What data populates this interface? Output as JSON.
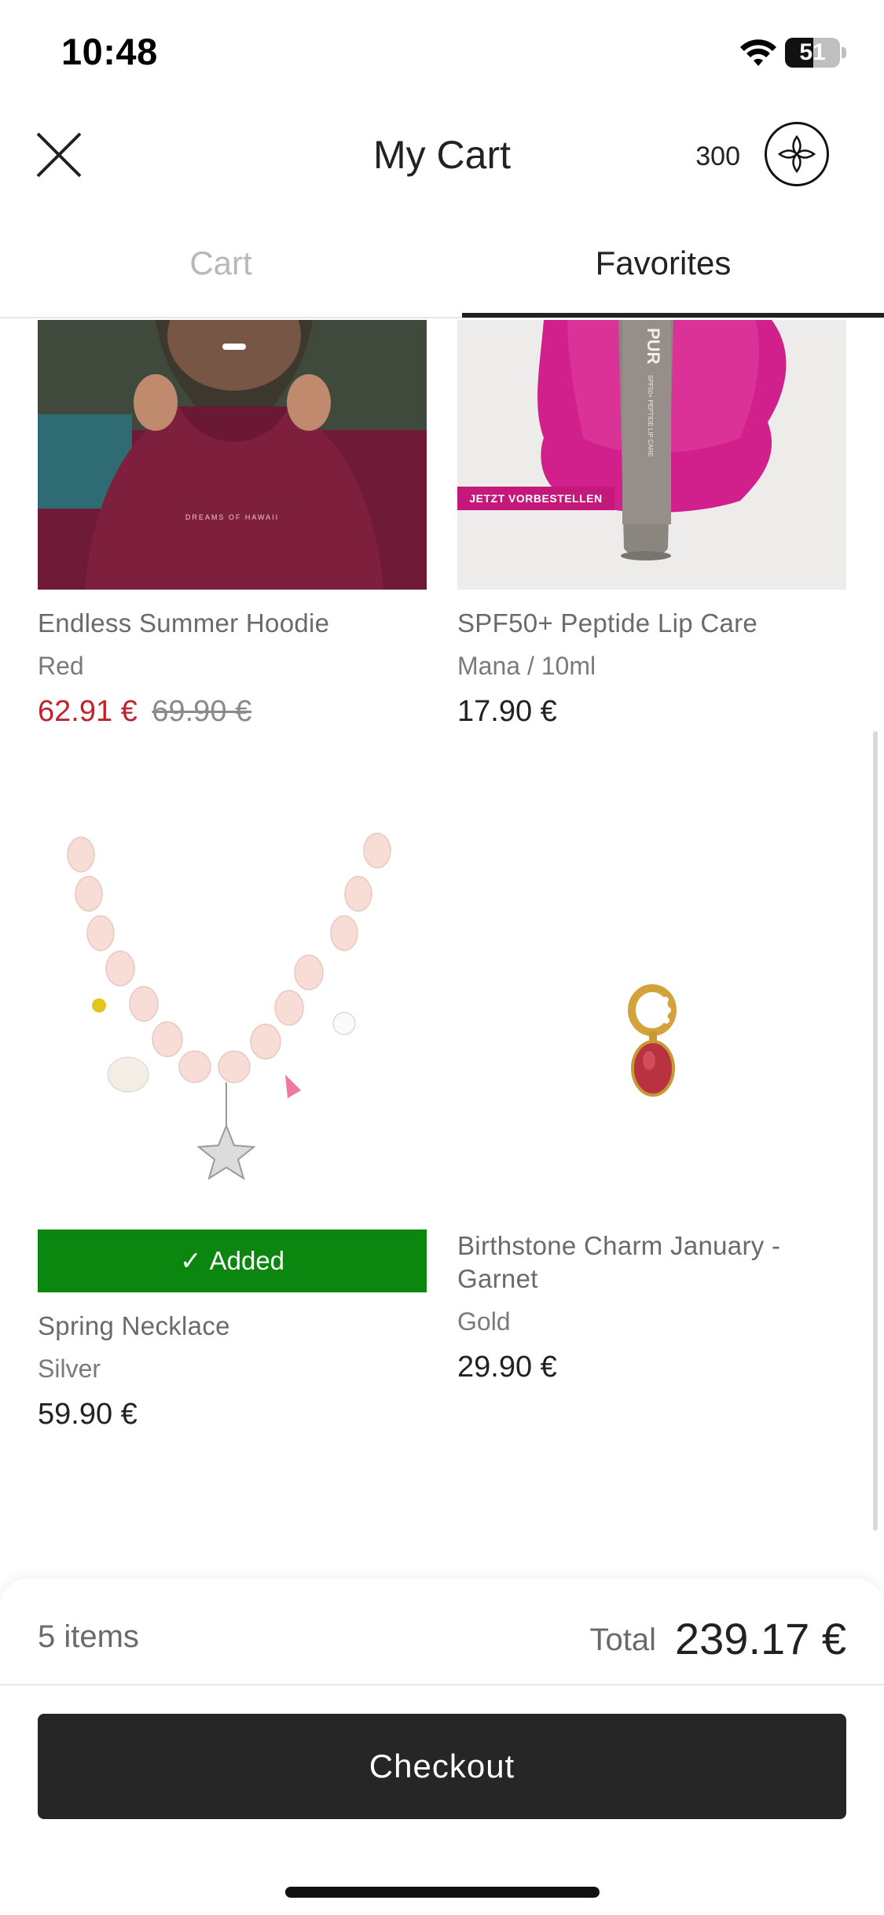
{
  "status_bar": {
    "time": "10:48",
    "battery_level": "51",
    "icons": [
      "wifi-icon",
      "battery-icon"
    ]
  },
  "header": {
    "title": "My Cart",
    "points": "300",
    "close_icon": "close-icon",
    "brand_icon": "flower-logo-icon"
  },
  "tabs": [
    {
      "label": "Cart",
      "active": false
    },
    {
      "label": "Favorites",
      "active": true
    }
  ],
  "favorites": [
    {
      "title": "Endless Summer Hoodie",
      "variant": "Red",
      "price": "62.91 €",
      "old_price": "69.90 €",
      "on_sale": true,
      "image_print": "DREAMS OF HAWAII"
    },
    {
      "title": "SPF50+ Peptide Lip Care",
      "variant": "Mana / 10ml",
      "price": "17.90 €",
      "image_banner": "JETZT VORBESTELLEN",
      "tube_brand": "PUR",
      "tube_sub": "SPF50+ PEPTIDE LIP CARE"
    },
    {
      "title": "Spring Necklace",
      "variant": "Silver",
      "price": "59.90 €",
      "badge": "Added",
      "badge_icon": "check-icon"
    },
    {
      "title": "Birthstone Charm January - Garnet",
      "variant": "Gold",
      "price": "29.90 €"
    }
  ],
  "summary": {
    "items": "5 items",
    "total_label": "Total",
    "total_value": "239.17 €",
    "checkout_label": "Checkout"
  },
  "colors": {
    "sale": "#c0242b",
    "added_badge": "#0b860f",
    "checkout": "#262626",
    "tab_inactive": "#b8b8b8"
  }
}
